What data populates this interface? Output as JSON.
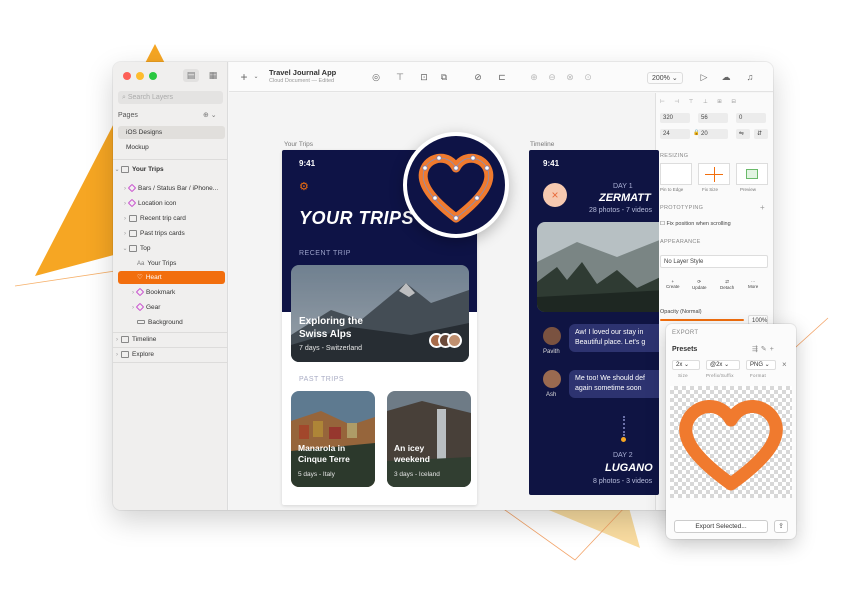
{
  "colors": {
    "accent": "#f26e0d",
    "navy": "#0e1346",
    "deco_orange": "#f6a623",
    "deco_yellow": "#f9dca0",
    "heart_orange": "#f07a2e"
  },
  "sidebar": {
    "search_placeholder": "Search Layers",
    "pages_label": "Pages",
    "pages": [
      {
        "label": "iOS Designs",
        "selected": true
      },
      {
        "label": "Mockup",
        "selected": false
      }
    ],
    "layers": [
      {
        "label": "Your Trips",
        "icon": "artboard-icon"
      },
      {
        "label": "Bars / Status Bar / iPhone...",
        "icon": "symbol-icon"
      },
      {
        "label": "Location icon",
        "icon": "symbol-icon"
      },
      {
        "label": "Recent trip card",
        "icon": "group-icon"
      },
      {
        "label": "Past trips cards",
        "icon": "group-icon"
      },
      {
        "label": "Top",
        "icon": "group-icon"
      },
      {
        "label": "Your Trips",
        "icon": "text-icon"
      },
      {
        "label": "Heart",
        "icon": "shape-icon",
        "highlighted": true
      },
      {
        "label": "Bookmark",
        "icon": "symbol-icon"
      },
      {
        "label": "Gear",
        "icon": "symbol-icon"
      },
      {
        "label": "Background",
        "icon": "rectangle-icon"
      },
      {
        "label": "Timeline",
        "icon": "artboard-icon"
      },
      {
        "label": "Explore",
        "icon": "artboard-icon"
      }
    ]
  },
  "toolbar": {
    "doc_title": "Travel Journal App",
    "doc_subtitle": "Cloud Document — Edited",
    "zoom": "200%"
  },
  "inspector": {
    "x": "320",
    "y": "56",
    "rotation": "0",
    "w": "24",
    "h": "20",
    "resizing_label": "RESIZING",
    "pin_label": "Pin to Edge",
    "fix_label": "Fix Size",
    "preview_label": "Preview",
    "prototyping_label": "PROTOTYPING",
    "fix_position": "Fix position when scrolling",
    "appearance_label": "APPEARANCE",
    "layer_style": "No Layer Style",
    "style_actions": [
      "Create",
      "Update",
      "Detach",
      "More"
    ],
    "opacity_label": "Opacity (Normal)",
    "opacity_value": "100%"
  },
  "artboards": {
    "your_trips_label": "Your Trips",
    "timeline_label": "Timeline"
  },
  "your_trips": {
    "time": "9:41",
    "title": "YOUR TRIPS",
    "recent_label": "RECENT TRIP",
    "recent_title_line1": "Exploring the",
    "recent_title_line2": "Swiss Alps",
    "recent_sub": "7 days - Switzerland",
    "past_label": "PAST TRIPS",
    "past": [
      {
        "line1": "Manarola in",
        "line2": "Cinque Terre",
        "sub": "5 days - Italy"
      },
      {
        "line1": "An icey",
        "line2": "weekend",
        "sub": "3 days - Iceland"
      }
    ]
  },
  "timeline": {
    "time": "9:41",
    "day1": "DAY 1",
    "place1": "ZERMATT",
    "meta1": "28 photos - 7 videos",
    "msg1_name": "Pavith",
    "msg1": "Aw! I loved our stay in Beautiful place. Let's g",
    "msg2_name": "Ash",
    "msg2": "Me too! We should def again sometime soon",
    "day2": "DAY 2",
    "place2": "LUGANO",
    "meta2": "8 photos - 3 videos"
  },
  "export": {
    "label": "EXPORT",
    "presets_label": "Presets",
    "size": "2x",
    "prefix": "@2x",
    "format": "PNG",
    "size_label": "Size",
    "prefix_label": "Prefix/Suffix",
    "format_label": "Format",
    "button": "Export Selected..."
  }
}
